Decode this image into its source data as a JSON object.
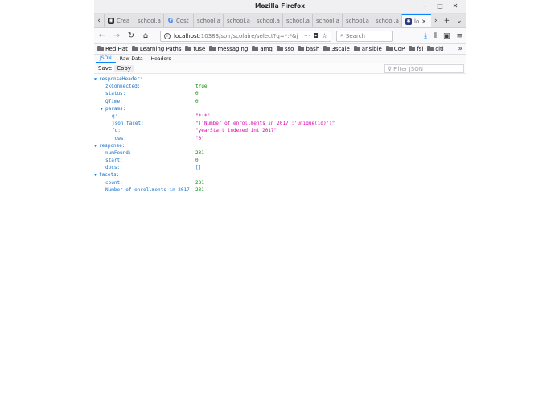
{
  "window": {
    "title": "Mozilla Firefox",
    "controls": [
      "–",
      "□",
      "✕"
    ]
  },
  "tabs": [
    {
      "label": "Crea",
      "icon": "github-icon",
      "active": false
    },
    {
      "label": "school.a",
      "icon": "none",
      "active": false
    },
    {
      "label": "Cost",
      "icon": "google-icon",
      "active": false
    },
    {
      "label": "school.a",
      "icon": "none",
      "active": false
    },
    {
      "label": "school.a",
      "icon": "none",
      "active": false
    },
    {
      "label": "school.a",
      "icon": "none",
      "active": false
    },
    {
      "label": "school.a",
      "icon": "none",
      "active": false
    },
    {
      "label": "school.a",
      "icon": "none",
      "active": false
    },
    {
      "label": "school.a",
      "icon": "none",
      "active": false
    },
    {
      "label": "school.a",
      "icon": "none",
      "active": false
    },
    {
      "label": "lo",
      "icon": "solr-icon",
      "active": true
    }
  ],
  "nav": {
    "url_host": "localhost",
    "url_rest": ":10383/solr/scolaire/select?q=*:*&j",
    "search_placeholder": "Search"
  },
  "bookmarks": [
    "Red Hat",
    "Learning Paths",
    "fuse",
    "messaging",
    "amq",
    "sso",
    "bash",
    "3scale",
    "ansible",
    "CoP",
    "fsi",
    "citi"
  ],
  "json_viewer": {
    "tabs": [
      "JSON",
      "Raw Data",
      "Headers"
    ],
    "buttons": {
      "save": "Save",
      "copy": "Copy"
    },
    "filter_placeholder": "Filter JSON",
    "rows": [
      {
        "key": "responseHeader:",
        "value": "",
        "type": "obj",
        "depth": 0
      },
      {
        "key": "zkConnected:",
        "value": "true",
        "type": "bool",
        "depth": 1
      },
      {
        "key": "status:",
        "value": "0",
        "type": "num",
        "depth": 1
      },
      {
        "key": "QTime:",
        "value": "0",
        "type": "num",
        "depth": 1
      },
      {
        "key": "params:",
        "value": "",
        "type": "obj",
        "depth": 1
      },
      {
        "key": "q:",
        "value": "\"*:*\"",
        "type": "str",
        "depth": 2
      },
      {
        "key": "json.facet:",
        "value": "\"{'Number of enrollments in 2017':'unique(id)'}\"",
        "type": "str",
        "depth": 2
      },
      {
        "key": "fq:",
        "value": "\"yearStart_indexed_int:2017\"",
        "type": "str",
        "depth": 2
      },
      {
        "key": "rows:",
        "value": "\"0\"",
        "type": "str",
        "depth": 2
      },
      {
        "key": "response:",
        "value": "",
        "type": "obj",
        "depth": 0
      },
      {
        "key": "numFound:",
        "value": "231",
        "type": "num",
        "depth": 1
      },
      {
        "key": "start:",
        "value": "0",
        "type": "num",
        "depth": 1
      },
      {
        "key": "docs:",
        "value": "[]",
        "type": "arr",
        "depth": 1
      },
      {
        "key": "facets:",
        "value": "",
        "type": "obj",
        "depth": 0
      },
      {
        "key": "count:",
        "value": "231",
        "type": "num",
        "depth": 1
      },
      {
        "key": "Number of enrollments in 2017:",
        "value": "231",
        "type": "num",
        "depth": 1
      }
    ]
  }
}
